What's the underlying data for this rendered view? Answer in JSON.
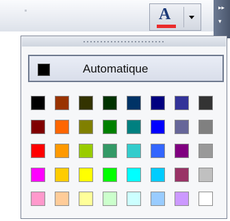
{
  "toolbar": {
    "font_color_button": {
      "letter": "A",
      "current_color": "#ea2b2b"
    }
  },
  "palette": {
    "automatic_label": "Automatique",
    "automatic_color": "#000000",
    "colors": [
      [
        "#000000",
        "#993300",
        "#333300",
        "#003300",
        "#003366",
        "#000080",
        "#333399",
        "#333333"
      ],
      [
        "#800000",
        "#ff6600",
        "#808000",
        "#008000",
        "#008080",
        "#0000ff",
        "#666699",
        "#808080"
      ],
      [
        "#ff0000",
        "#ff9900",
        "#99cc00",
        "#339966",
        "#33cccc",
        "#3366ff",
        "#800080",
        "#999999"
      ],
      [
        "#ff00ff",
        "#ffcc00",
        "#ffff00",
        "#00ff00",
        "#00ffff",
        "#00ccff",
        "#993366",
        "#c0c0c0"
      ],
      [
        "#ff99cc",
        "#ffcc99",
        "#ffff99",
        "#ccffcc",
        "#ccffff",
        "#99ccff",
        "#cc99ff",
        "#ffffff"
      ]
    ]
  }
}
